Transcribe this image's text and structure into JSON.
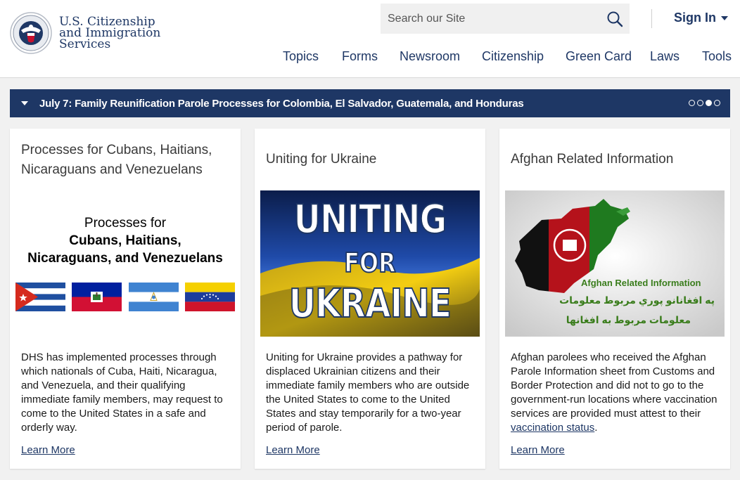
{
  "header": {
    "agency_line1": "U.S. Citizenship",
    "agency_line2": "and Immigration",
    "agency_line3": "Services",
    "search_placeholder": "Search our Site",
    "signin_label": "Sign In"
  },
  "nav": [
    {
      "label": "Topics"
    },
    {
      "label": "Forms"
    },
    {
      "label": "Newsroom"
    },
    {
      "label": "Citizenship"
    },
    {
      "label": "Green Card"
    },
    {
      "label": "Laws"
    },
    {
      "label": "Tools"
    }
  ],
  "alert": {
    "text": "July 7: Family Reunification Parole Processes for Colombia, El Salvador, Guatemala, and Honduras",
    "slide_count": 4,
    "active_slide": 3
  },
  "cards": [
    {
      "title": "Processes for Cubans, Haitians, Nicaraguans and Venezuelans",
      "image_heading_line1": "Processes for",
      "image_heading_line2": "Cubans, Haitians,",
      "image_heading_line3": "Nicaraguans, and Venezuelans",
      "description": "DHS has implemented processes through which nationals of Cuba, Haiti, Nicaragua, and Venezuela, and their qualifying immediate family members, may request to come to the United States in a safe and orderly way.",
      "link": "Learn More"
    },
    {
      "title": "Uniting for Ukraine",
      "image_line1": "UNITING",
      "image_line2": "FOR",
      "image_line3": "UKRAINE",
      "description": "Uniting for Ukraine provides a pathway for displaced Ukrainian citizens and their immediate family members who are outside the United States to come to the United States and stay temporarily for a two-year period of parole.",
      "link": "Learn More"
    },
    {
      "title": "Afghan Related Information",
      "image_line1": "Afghan Related Information",
      "image_line2": "په افغانانو پوري مربوط معلومات",
      "image_line3": "معلومات مربوط به افغانها",
      "description_before": "Afghan parolees who received the Afghan Parole Information sheet from Customs and Border Protection and did not to go to the government-run locations where vaccination services are provided must attest to their ",
      "description_link": "vaccination status",
      "description_after": ".",
      "link": "Learn More"
    }
  ],
  "colors": {
    "brand_navy": "#1e3765",
    "afghan_green": "#3a7d1c",
    "ukraine_blue": "#1f4aa8",
    "ukraine_yellow": "#f3cd12"
  }
}
